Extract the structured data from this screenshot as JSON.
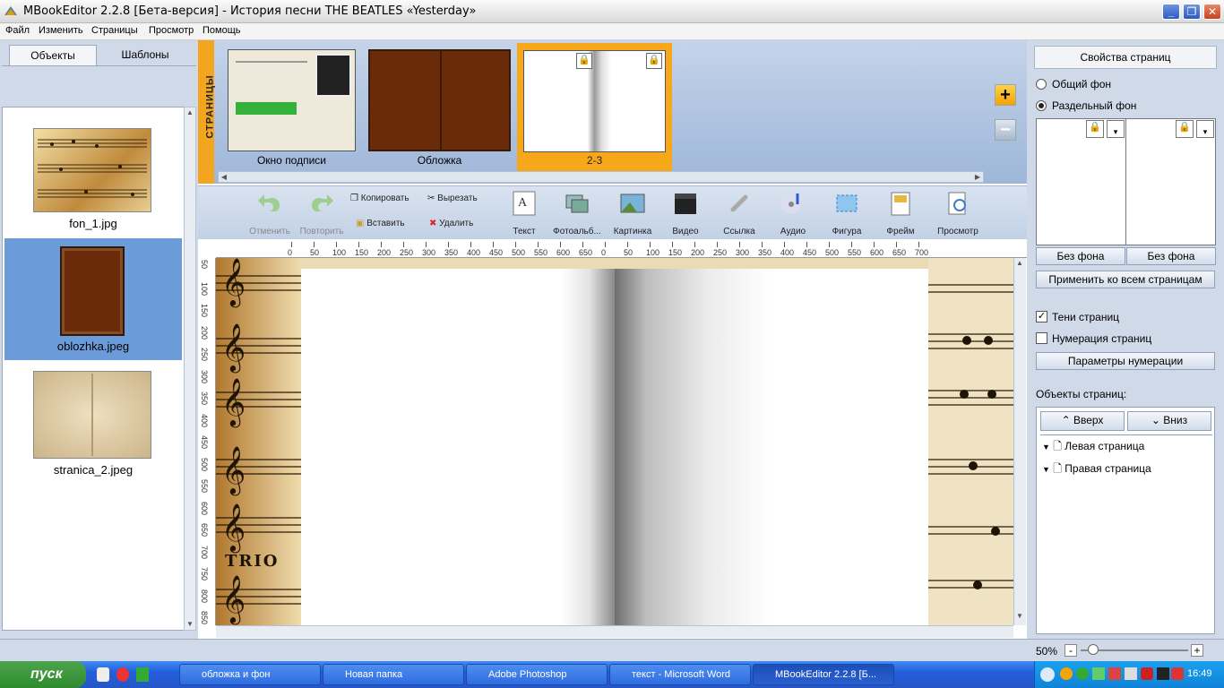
{
  "window": {
    "title": "MBookEditor 2.2.8 [Бета-версия] - История песни THE BEATLES «Yesterday»"
  },
  "menu": [
    "Файл",
    "Изменить",
    "Страницы",
    "Просмотр",
    "Помощь"
  ],
  "left_panel": {
    "tabs": [
      "Объекты",
      "Шаблоны"
    ],
    "objects": [
      {
        "label": "fon_1.jpg"
      },
      {
        "label": "oblozhka.jpeg"
      },
      {
        "label": "stranica_2.jpeg"
      }
    ]
  },
  "pages": {
    "vertical_label": "СТРАНИЦЫ",
    "items": [
      {
        "label": "Окно подписи"
      },
      {
        "label": "Обложка"
      },
      {
        "label": "2-3"
      }
    ]
  },
  "toolbar": {
    "undo": "Отменить",
    "redo": "Повторить",
    "copy": "Копировать",
    "cut": "Вырезать",
    "paste": "Вставить",
    "delete": "Удалить",
    "text": "Текст",
    "photoalbum": "Фотоальб...",
    "picture": "Картинка",
    "video": "Видео",
    "link": "Ссылка",
    "audio": "Аудио",
    "shape": "Фигура",
    "frame": "Фрейм",
    "preview": "Просмотр"
  },
  "ruler": {
    "h_ticks": [
      "0",
      "50",
      "100",
      "150",
      "200",
      "250",
      "300",
      "350",
      "400",
      "450",
      "500",
      "550",
      "600",
      "650",
      "0",
      "50",
      "100",
      "150",
      "200",
      "250",
      "300",
      "350",
      "400",
      "450",
      "500",
      "550",
      "600",
      "650",
      "700"
    ],
    "v_ticks": [
      "50",
      "100",
      "150",
      "200",
      "250",
      "300",
      "350",
      "400",
      "450",
      "500",
      "550",
      "600",
      "650",
      "700",
      "750",
      "800",
      "850"
    ]
  },
  "canvas": {
    "bg_text": "TRIO"
  },
  "right_panel": {
    "title": "Свойства страниц",
    "radio_common": "Общий фон",
    "radio_split": "Раздельный фон",
    "no_bg_left": "Без фона",
    "no_bg_right": "Без фона",
    "apply_all": "Применить ко всем страницам",
    "shadows": "Тени страниц",
    "numbering": "Нумерация страниц",
    "numbering_params": "Параметры нумерации",
    "objects_label": "Объекты страниц:",
    "up": "Вверх",
    "down": "Вниз",
    "tree": [
      "Левая страница",
      "Правая страница"
    ]
  },
  "status": {
    "zoom": "50%"
  },
  "taskbar": {
    "start": "пуск",
    "tasks": [
      "обложка и фон",
      "Новая папка",
      "Adobe Photoshop",
      "текст - Microsoft Word",
      "MBookEditor 2.2.8 [Б..."
    ],
    "clock": "16:49"
  }
}
